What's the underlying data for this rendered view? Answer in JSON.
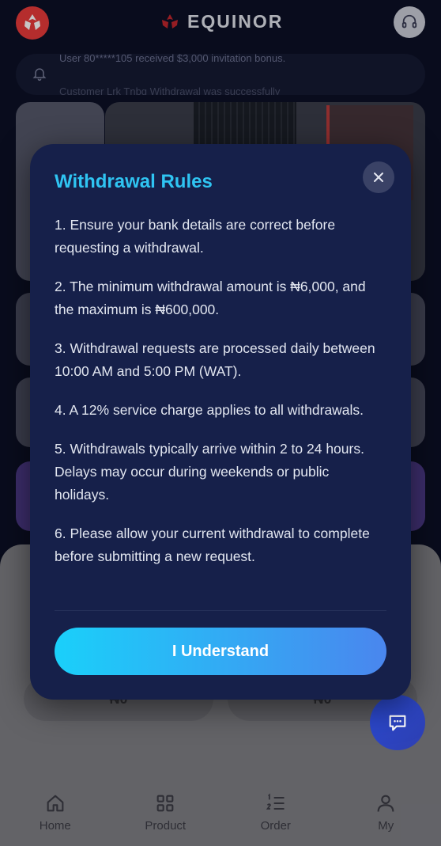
{
  "header": {
    "brand": "EQUINOR",
    "logo_icon": "equinor-logo-icon",
    "support_icon": "headset-icon"
  },
  "notice": {
    "line1": "User 80*****105 received $3,000 invitation bonus.",
    "line2": "Customer Lrk Tnbq Withdrawal was successfully"
  },
  "stats": {
    "left_value": "₦0",
    "right_value": "₦0"
  },
  "tabs": [
    {
      "label": "Home",
      "icon": "home-icon"
    },
    {
      "label": "Product",
      "icon": "grid-icon"
    },
    {
      "label": "Order",
      "icon": "list-icon"
    },
    {
      "label": "My",
      "icon": "user-icon"
    }
  ],
  "modal": {
    "title": "Withdrawal Rules",
    "rules": [
      "1. Ensure your bank details are correct before requesting a withdrawal.",
      "2. The minimum withdrawal amount is ₦6,000, and the maximum is ₦600,000.",
      "3. Withdrawal requests are processed daily between 10:00 AM and 5:00 PM (WAT).",
      "4. A 12% service charge applies to all withdrawals.",
      "5. Withdrawals typically arrive within 2 to 24 hours. Delays may occur during weekends or public holidays.",
      "6. Please allow your current withdrawal to complete before submitting a new request."
    ],
    "confirm_label": "I Understand"
  },
  "colors": {
    "accent": "#2fc4f2",
    "button_start": "#1ad0fa",
    "button_end": "#4a86ee",
    "modal_bg": "#16204a"
  }
}
